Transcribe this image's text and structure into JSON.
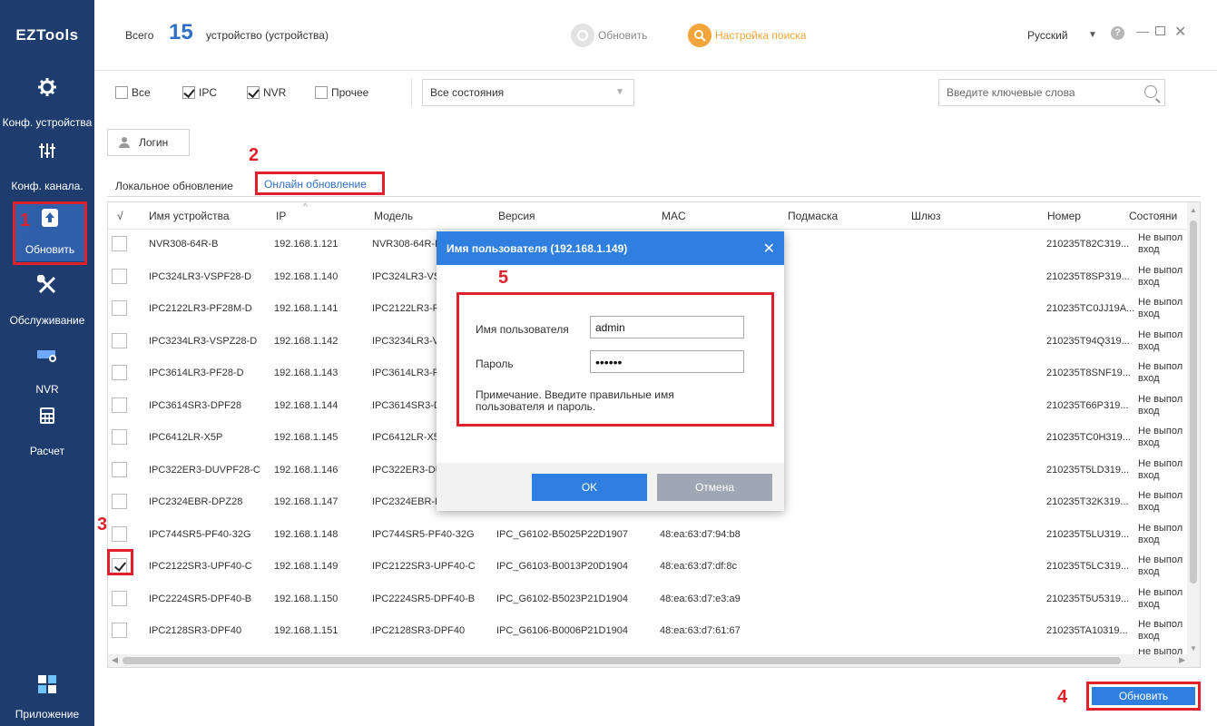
{
  "app": {
    "logo": "EZTools"
  },
  "sidebar": {
    "items": [
      {
        "label": "Конф. устройства",
        "icon": "gear-icon"
      },
      {
        "label": "Конф. канала.",
        "icon": "sliders-icon"
      },
      {
        "label": "Обновить",
        "icon": "update-icon",
        "active": true
      },
      {
        "label": "Обслуживание",
        "icon": "tools-icon"
      },
      {
        "label": "NVR",
        "icon": "nvr-icon"
      },
      {
        "label": "Расчет",
        "icon": "calculator-icon"
      },
      {
        "label": "Приложение",
        "icon": "app-grid-icon"
      }
    ]
  },
  "header": {
    "total_label": "Всего",
    "total_count": "15",
    "total_suffix": "устройство (устройства)",
    "refresh": "Обновить",
    "search_settings": "Настройка поиска",
    "language": "Русский",
    "help": "?"
  },
  "filters": {
    "all": "Все",
    "ipc": "IPC",
    "nvr": "NVR",
    "other": "Прочее",
    "checked": {
      "all": false,
      "ipc": true,
      "nvr": true,
      "other": false
    },
    "status": "Все состояния",
    "keyword_placeholder": "Введите ключевые слова"
  },
  "login_button": "Логин",
  "tabs": {
    "local": "Локальное обновление",
    "online": "Онлайн обновление"
  },
  "table": {
    "columns": [
      "√",
      "Имя устройства",
      "IP",
      "Модель",
      "Версия",
      "MAC",
      "Подмаска",
      "Шлюз",
      "Номер",
      "Состояни"
    ],
    "rows": [
      {
        "name": "NVR308-64R-B",
        "ip": "192.168.1.121",
        "model": "NVR308-64R-B",
        "version": "",
        "mac": "",
        "serial": "210235T82C319...",
        "status1": "Не выпол",
        "status2": "вход",
        "checked": false
      },
      {
        "name": "IPC324LR3-VSPF28-D",
        "ip": "192.168.1.140",
        "model": "IPC324LR3-VSPF28-D",
        "version": "",
        "mac": "",
        "serial": "210235T8SP319...",
        "status1": "Не выпол",
        "status2": "вход",
        "checked": false
      },
      {
        "name": "IPC2122LR3-PF28M-D",
        "ip": "192.168.1.141",
        "model": "IPC2122LR3-PF28M-D",
        "version": "",
        "mac": "",
        "serial": "210235TC0JJ19A...",
        "status1": "Не выпол",
        "status2": "вход",
        "checked": false
      },
      {
        "name": "IPC3234LR3-VSPZ28-D",
        "ip": "192.168.1.142",
        "model": "IPC3234LR3-VSPZ28-D",
        "version": "",
        "mac": "",
        "serial": "210235T94Q319...",
        "status1": "Не выпол",
        "status2": "вход",
        "checked": false
      },
      {
        "name": "IPC3614LR3-PF28-D",
        "ip": "192.168.1.143",
        "model": "IPC3614LR3-PF28-D",
        "version": "",
        "mac": "",
        "serial": "210235T8SNF19...",
        "status1": "Не выпол",
        "status2": "вход",
        "checked": false
      },
      {
        "name": "IPC3614SR3-DPF28",
        "ip": "192.168.1.144",
        "model": "IPC3614SR3-DPF28",
        "version": "",
        "mac": "",
        "serial": "210235T66P319...",
        "status1": "Не выпол",
        "status2": "вход",
        "checked": false
      },
      {
        "name": "IPC6412LR-X5P",
        "ip": "192.168.1.145",
        "model": "IPC6412LR-X5P",
        "version": "",
        "mac": "",
        "serial": "210235TC0H319...",
        "status1": "Не выпол",
        "status2": "вход",
        "checked": false
      },
      {
        "name": "IPC322ER3-DUVPF28-C",
        "ip": "192.168.1.146",
        "model": "IPC322ER3-DUVPF28-C",
        "version": "",
        "mac": "",
        "serial": "210235T5LD319...",
        "status1": "Не выпол",
        "status2": "вход",
        "checked": false
      },
      {
        "name": "IPC2324EBR-DPZ28",
        "ip": "192.168.1.147",
        "model": "IPC2324EBR-DPZ28",
        "version": "",
        "mac": "",
        "serial": "210235T32K319...",
        "status1": "Не выпол",
        "status2": "вход",
        "checked": false
      },
      {
        "name": "IPC744SR5-PF40-32G",
        "ip": "192.168.1.148",
        "model": "IPC744SR5-PF40-32G",
        "version": "IPC_G6102-B5025P22D1907",
        "mac": "48:ea:63:d7:94:b8",
        "serial": "210235T5LU319...",
        "status1": "Не выпол",
        "status2": "вход",
        "checked": false
      },
      {
        "name": "IPC2122SR3-UPF40-C",
        "ip": "192.168.1.149",
        "model": "IPC2122SR3-UPF40-C",
        "version": "IPC_G6103-B0013P20D1904",
        "mac": "48:ea:63:d7:df:8c",
        "serial": "210235T5LC319...",
        "status1": "Не выпол",
        "status2": "вход",
        "checked": true
      },
      {
        "name": "IPC2224SR5-DPF40-B",
        "ip": "192.168.1.150",
        "model": "IPC2224SR5-DPF40-B",
        "version": "IPC_G6102-B5023P21D1904",
        "mac": "48:ea:63:d7:e3:a9",
        "serial": "210235T5U5319...",
        "status1": "Не выпол",
        "status2": "вход",
        "checked": false
      },
      {
        "name": "IPC2128SR3-DPF40",
        "ip": "192.168.1.151",
        "model": "IPC2128SR3-DPF40",
        "version": "IPC_G6106-B0006P21D1904",
        "mac": "48:ea:63:d7:61:67",
        "serial": "210235TA10319...",
        "status1": "Не выпол",
        "status2": "вход",
        "checked": false
      }
    ],
    "partial_status": "Не выпол"
  },
  "dialog": {
    "title": "Имя пользователя (192.168.1.149)",
    "username_label": "Имя пользователя",
    "username_value": "admin",
    "password_label": "Пароль",
    "password_value": "••••••",
    "note": "Примечание. Введите правильные имя пользователя и пароль.",
    "ok": "OK",
    "cancel": "Отмена"
  },
  "update_button": "Обновить",
  "annotations": {
    "n1": "1",
    "n2": "2",
    "n3": "3",
    "n4": "4",
    "n5": "5"
  },
  "colors": {
    "sidebar": "#1e3c6d",
    "accent": "#2f7fe0",
    "annotation": "#e0202a",
    "orange": "#f3a53b"
  }
}
